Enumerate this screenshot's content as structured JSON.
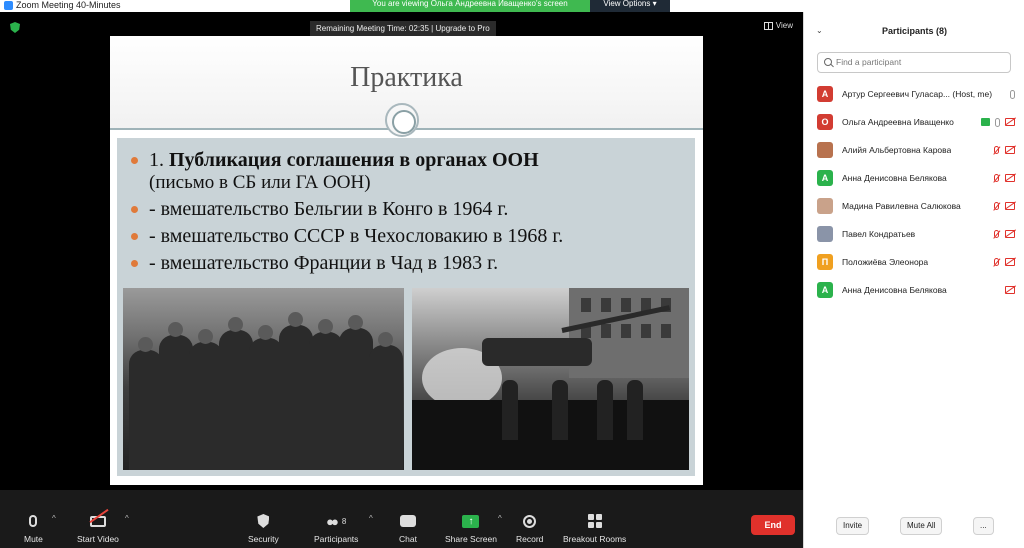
{
  "window": {
    "title": "Zoom Meeting 40-Minutes",
    "banner": "You are viewing Ольга Андреевна Иващенко's screen",
    "view_options": "View Options"
  },
  "meeting": {
    "remaining_time": "Remaining Meeting Time: 02:35 | Upgrade to Pro",
    "view_label": "View"
  },
  "slide": {
    "title": "Практика",
    "bullets": [
      {
        "prefix": "1. ",
        "bold": "Публикация соглашения в органах ООН",
        "sub": "(письмо в СБ или ГА ООН)"
      },
      {
        "text": "- вмешательство Бельгии в Конго в 1964 г."
      },
      {
        "text": "- вмешательство СССР в Чехословакию в 1968 г."
      },
      {
        "text": "- вмешательство Франции в Чад в 1983 г."
      }
    ]
  },
  "toolbar": {
    "mute": "Mute",
    "start_video": "Start Video",
    "security": "Security",
    "participants": "Participants",
    "participants_count": "8",
    "chat": "Chat",
    "share_screen": "Share Screen",
    "record": "Record",
    "breakout_rooms": "Breakout Rooms",
    "end": "End"
  },
  "panel": {
    "header": "Participants (8)",
    "search_placeholder": "Find a participant",
    "participants": [
      {
        "initial": "А",
        "color": "#d23c32",
        "name": "Артур Сергеевич Гуласар... (Host, me)",
        "mic": "on",
        "cam": "none",
        "share": false
      },
      {
        "initial": "О",
        "color": "#d23c32",
        "name": "Ольга Андреевна Иващенко",
        "mic": "on",
        "cam": "off",
        "share": true
      },
      {
        "initial": "",
        "color": "#b8724e",
        "name": "Алийя Альбертовна Карова",
        "mic": "off",
        "cam": "off",
        "share": false
      },
      {
        "initial": "А",
        "color": "#2bb24c",
        "name": "Анна Денисовна Белякова",
        "mic": "off",
        "cam": "off",
        "share": false
      },
      {
        "initial": "",
        "color": "#c9a28a",
        "name": "Мадина Равилевна Салюкова",
        "mic": "off",
        "cam": "off",
        "share": false
      },
      {
        "initial": "",
        "color": "#8a94a8",
        "name": "Павел Кондратьев",
        "mic": "off",
        "cam": "off",
        "share": false
      },
      {
        "initial": "П",
        "color": "#f0a020",
        "name": "Положиёва Элеонора",
        "mic": "off",
        "cam": "off",
        "share": false
      },
      {
        "initial": "А",
        "color": "#2bb24c",
        "name": "Анна Денисовна Белякова",
        "mic": "none",
        "cam": "off",
        "share": false
      }
    ],
    "invite": "Invite",
    "mute_all": "Mute All",
    "more": "..."
  }
}
